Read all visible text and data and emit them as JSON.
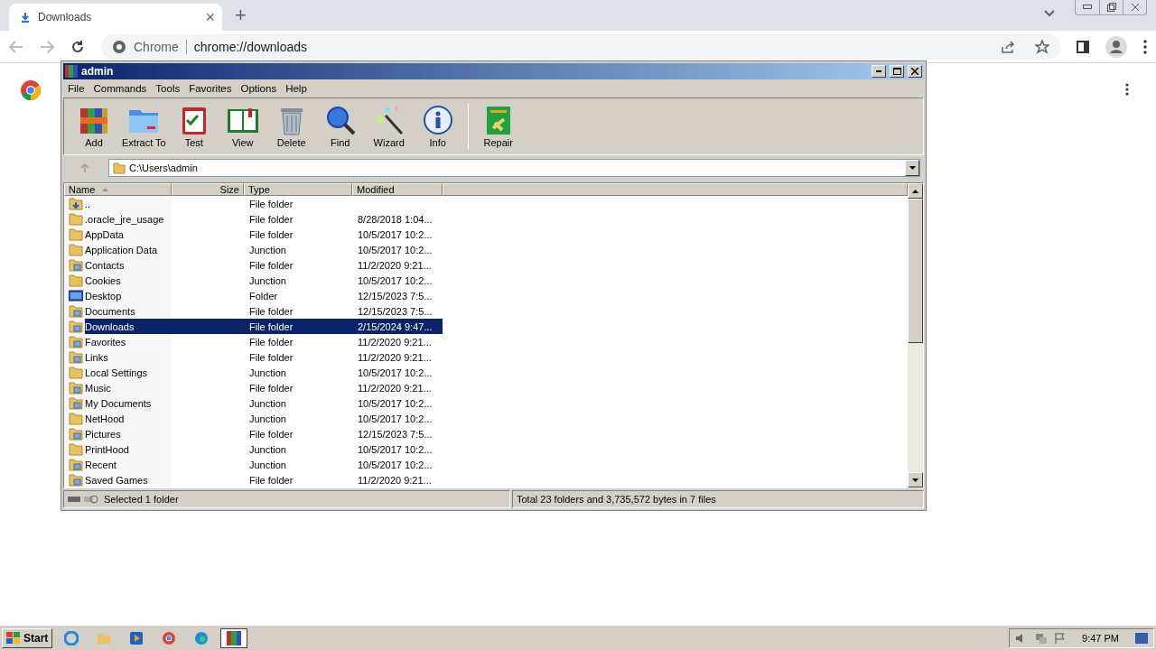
{
  "browser": {
    "tab": {
      "title": "Downloads",
      "close": "×"
    },
    "new_tab": "+",
    "omnibox": {
      "label": "Chrome",
      "url": "chrome://downloads"
    }
  },
  "winrar": {
    "title": "admin",
    "menu": [
      "File",
      "Commands",
      "Tools",
      "Favorites",
      "Options",
      "Help"
    ],
    "toolbar": [
      {
        "label": "Add",
        "kind": "add"
      },
      {
        "label": "Extract To",
        "kind": "extract"
      },
      {
        "label": "Test",
        "kind": "test"
      },
      {
        "label": "View",
        "kind": "view"
      },
      {
        "label": "Delete",
        "kind": "delete"
      },
      {
        "label": "Find",
        "kind": "find"
      },
      {
        "label": "Wizard",
        "kind": "wizard"
      },
      {
        "label": "Info",
        "kind": "info"
      },
      {
        "label": "Repair",
        "kind": "repair"
      }
    ],
    "path": "C:\\Users\\admin",
    "columns": [
      "Name",
      "Size",
      "Type",
      "Modified"
    ],
    "rows": [
      {
        "name": "..",
        "type": "File folder",
        "kind": "up",
        "selected": false
      },
      {
        "name": ".oracle_jre_usage",
        "type": "File folder",
        "modified": "8/28/2018 1:04...",
        "kind": "folder",
        "selected": false
      },
      {
        "name": "AppData",
        "type": "File folder",
        "modified": "10/5/2017 10:2...",
        "kind": "folder",
        "selected": false
      },
      {
        "name": "Application Data",
        "type": "Junction",
        "modified": "10/5/2017 10:2...",
        "kind": "folder",
        "selected": false
      },
      {
        "name": "Contacts",
        "type": "File folder",
        "modified": "11/2/2020 9:21...",
        "kind": "special",
        "selected": false
      },
      {
        "name": "Cookies",
        "type": "Junction",
        "modified": "10/5/2017 10:2...",
        "kind": "folder",
        "selected": false
      },
      {
        "name": "Desktop",
        "type": "Folder",
        "modified": "12/15/2023 7:5...",
        "kind": "desktop",
        "selected": false
      },
      {
        "name": "Documents",
        "type": "File folder",
        "modified": "12/15/2023 7:5...",
        "kind": "special",
        "selected": false
      },
      {
        "name": "Downloads",
        "type": "File folder",
        "modified": "2/15/2024 9:47...",
        "kind": "special",
        "selected": true
      },
      {
        "name": "Favorites",
        "type": "File folder",
        "modified": "11/2/2020 9:21...",
        "kind": "special",
        "selected": false
      },
      {
        "name": "Links",
        "type": "File folder",
        "modified": "11/2/2020 9:21...",
        "kind": "special",
        "selected": false
      },
      {
        "name": "Local Settings",
        "type": "Junction",
        "modified": "10/5/2017 10:2...",
        "kind": "folder",
        "selected": false
      },
      {
        "name": "Music",
        "type": "File folder",
        "modified": "11/2/2020 9:21...",
        "kind": "special",
        "selected": false
      },
      {
        "name": "My Documents",
        "type": "Junction",
        "modified": "10/5/2017 10:2...",
        "kind": "special",
        "selected": false
      },
      {
        "name": "NetHood",
        "type": "Junction",
        "modified": "10/5/2017 10:2...",
        "kind": "folder",
        "selected": false
      },
      {
        "name": "Pictures",
        "type": "File folder",
        "modified": "12/15/2023 7:5...",
        "kind": "special",
        "selected": false
      },
      {
        "name": "PrintHood",
        "type": "Junction",
        "modified": "10/5/2017 10:2...",
        "kind": "folder",
        "selected": false
      },
      {
        "name": "Recent",
        "type": "Junction",
        "modified": "10/5/2017 10:2...",
        "kind": "special",
        "selected": false
      },
      {
        "name": "Saved Games",
        "type": "File folder",
        "modified": "11/2/2020 9:21...",
        "kind": "special",
        "selected": false
      }
    ],
    "status": {
      "left": "Selected 1 folder",
      "right": "Total 23 folders and 3,735,572 bytes in 7 files"
    }
  },
  "taskbar": {
    "start": "Start",
    "clock": "9:47 PM"
  }
}
